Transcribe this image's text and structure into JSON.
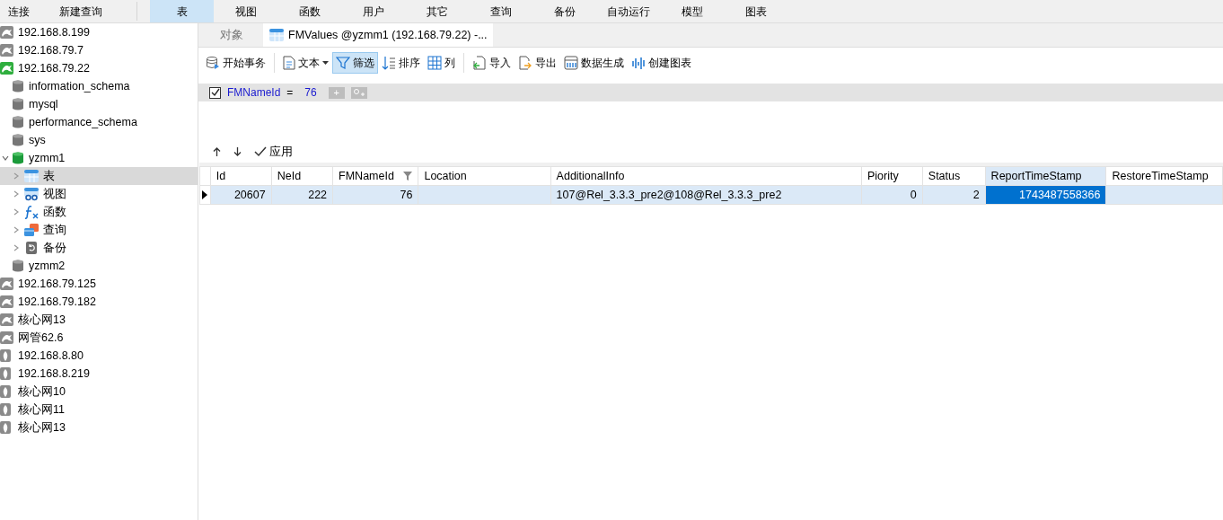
{
  "menu_actions": [
    {
      "label": "连接"
    },
    {
      "label": "新建查询"
    }
  ],
  "object_types": [
    {
      "label": "表",
      "selected": true
    },
    {
      "label": "视图",
      "selected": false
    },
    {
      "label": "函数",
      "selected": false
    },
    {
      "label": "用户",
      "selected": false
    },
    {
      "label": "其它",
      "selected": false
    },
    {
      "label": "查询",
      "selected": false
    },
    {
      "label": "备份",
      "selected": false
    },
    {
      "label": "自动运行",
      "selected": false
    },
    {
      "label": "模型",
      "selected": false
    },
    {
      "label": "图表",
      "selected": false
    }
  ],
  "tree": [
    {
      "kind": "mysql",
      "label": "192.168.8.199",
      "connected": false,
      "selected": false
    },
    {
      "kind": "mysql",
      "label": "192.168.79.7",
      "connected": false,
      "selected": false
    },
    {
      "kind": "mysql",
      "label": "192.168.79.22",
      "connected": true,
      "selected": false,
      "children": [
        {
          "kind": "database",
          "label": "information_schema",
          "connected": false,
          "selected": false
        },
        {
          "kind": "database",
          "label": "mysql",
          "connected": false,
          "selected": false
        },
        {
          "kind": "database",
          "label": "performance_schema",
          "connected": false,
          "selected": false
        },
        {
          "kind": "database",
          "label": "sys",
          "connected": false,
          "selected": false
        },
        {
          "kind": "database",
          "label": "yzmm1",
          "connected": true,
          "selected": false,
          "expanded": true,
          "children": [
            {
              "kind": "tables",
              "label": "表",
              "expanded": false,
              "selected": true
            },
            {
              "kind": "views",
              "label": "视图",
              "expanded": false,
              "selected": false
            },
            {
              "kind": "functions",
              "label": "函数",
              "expanded": false,
              "selected": false
            },
            {
              "kind": "queries",
              "label": "查询",
              "expanded": false,
              "selected": false
            },
            {
              "kind": "backups",
              "label": "备份",
              "expanded": false,
              "selected": false
            }
          ]
        },
        {
          "kind": "database",
          "label": "yzmm2",
          "connected": false,
          "selected": false
        }
      ]
    },
    {
      "kind": "mysql",
      "label": "192.168.79.125",
      "connected": false,
      "selected": false
    },
    {
      "kind": "mysql",
      "label": "192.168.79.182",
      "connected": false,
      "selected": false
    },
    {
      "kind": "mysql",
      "label": "核心网13",
      "connected": false,
      "selected": false
    },
    {
      "kind": "mysql",
      "label": "网管62.6",
      "connected": false,
      "selected": false
    },
    {
      "kind": "mongo",
      "label": "192.168.8.80",
      "connected": false,
      "selected": false
    },
    {
      "kind": "mongo",
      "label": "192.168.8.219",
      "connected": false,
      "selected": false
    },
    {
      "kind": "mongo",
      "label": "核心网10",
      "connected": false,
      "selected": false
    },
    {
      "kind": "mongo",
      "label": "核心网11",
      "connected": false,
      "selected": false
    },
    {
      "kind": "mongo",
      "label": "核心网13",
      "connected": false,
      "selected": false
    }
  ],
  "tabs": [
    {
      "kind": "objects",
      "label": "对象",
      "selected": false
    },
    {
      "kind": "table",
      "label": "FMValues @yzmm1 (192.168.79.22) -...",
      "selected": true
    }
  ],
  "toolbar_groups": [
    {
      "items": [
        {
          "kind": "transaction",
          "label": "开始事务",
          "active": false
        }
      ]
    },
    {
      "items": [
        {
          "kind": "text",
          "label": "文本",
          "active": false,
          "dropdown": true
        },
        {
          "kind": "filter",
          "label": "筛选",
          "active": true
        },
        {
          "kind": "sort",
          "label": "排序",
          "active": false
        },
        {
          "kind": "columns",
          "label": "列",
          "active": false
        }
      ]
    },
    {
      "items": [
        {
          "kind": "import",
          "label": "导入",
          "active": false
        },
        {
          "kind": "export",
          "label": "导出",
          "active": false
        },
        {
          "kind": "generate",
          "label": "数据生成",
          "active": false
        },
        {
          "kind": "chart",
          "label": "创建图表",
          "active": false
        }
      ]
    }
  ],
  "filter": {
    "checked": true,
    "field": "FMNameId",
    "operator": "=",
    "value": "76",
    "add_label": "+"
  },
  "filter_actions": [
    {
      "kind": "up"
    },
    {
      "kind": "down"
    },
    {
      "kind": "apply",
      "label": "应用"
    }
  ],
  "table": {
    "columns": [
      {
        "label": "Id",
        "kind": "number",
        "filtered": false,
        "selected": false
      },
      {
        "label": "NeId",
        "kind": "number",
        "filtered": false,
        "selected": false
      },
      {
        "label": "FMNameId",
        "kind": "number",
        "filtered": true,
        "selected": false
      },
      {
        "label": "Location",
        "kind": "text",
        "filtered": false,
        "selected": false
      },
      {
        "label": "AdditionalInfo",
        "kind": "text",
        "filtered": false,
        "selected": false
      },
      {
        "label": "Piority",
        "kind": "number",
        "filtered": false,
        "selected": false
      },
      {
        "label": "Status",
        "kind": "number",
        "filtered": false,
        "selected": false
      },
      {
        "label": "ReportTimeStamp",
        "kind": "number",
        "filtered": false,
        "selected": true
      },
      {
        "label": "RestoreTimeStamp",
        "kind": "number",
        "filtered": false,
        "selected": false
      }
    ],
    "rows": [
      {
        "current": true,
        "cells": [
          {
            "text": "20607",
            "selected": false
          },
          {
            "text": "222",
            "selected": false
          },
          {
            "text": "76",
            "selected": false
          },
          {
            "selected": false
          },
          {
            "text": "107@Rel_3.3.3_pre2@108@Rel_3.3.3_pre2",
            "selected": false
          },
          {
            "text": "0",
            "selected": false
          },
          {
            "text": "2",
            "selected": false
          },
          {
            "text": "1743487558366",
            "selected": true
          },
          {
            "selected": false
          }
        ]
      }
    ]
  }
}
